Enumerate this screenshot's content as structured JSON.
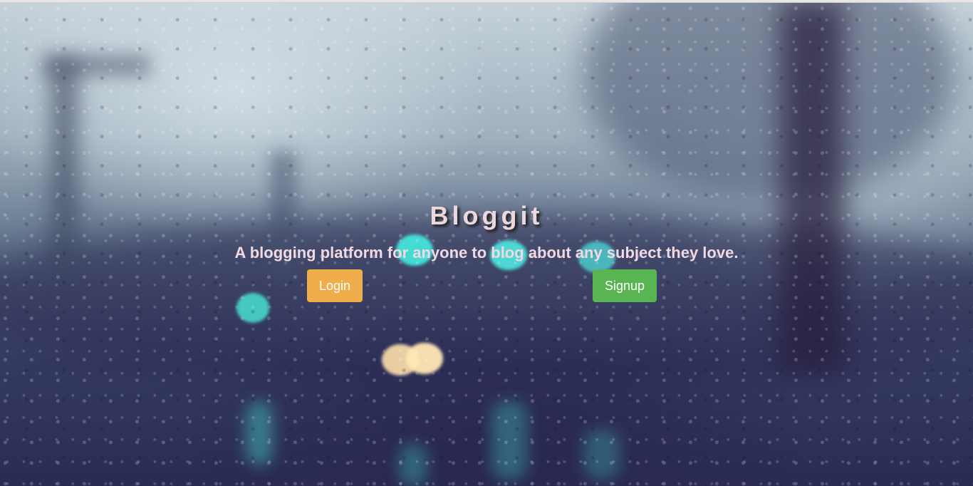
{
  "hero": {
    "title": "Bloggit",
    "tagline": "A blogging platform for anyone to blog about any subject they love."
  },
  "actions": {
    "login_label": "Login",
    "signup_label": "Signup"
  },
  "colors": {
    "login_button": "#efae49",
    "signup_button": "#58b551",
    "title_text": "#ead8dc",
    "tagline_text": "#f0d9e2"
  },
  "background": {
    "description_icon": "rainy-window-photo"
  }
}
